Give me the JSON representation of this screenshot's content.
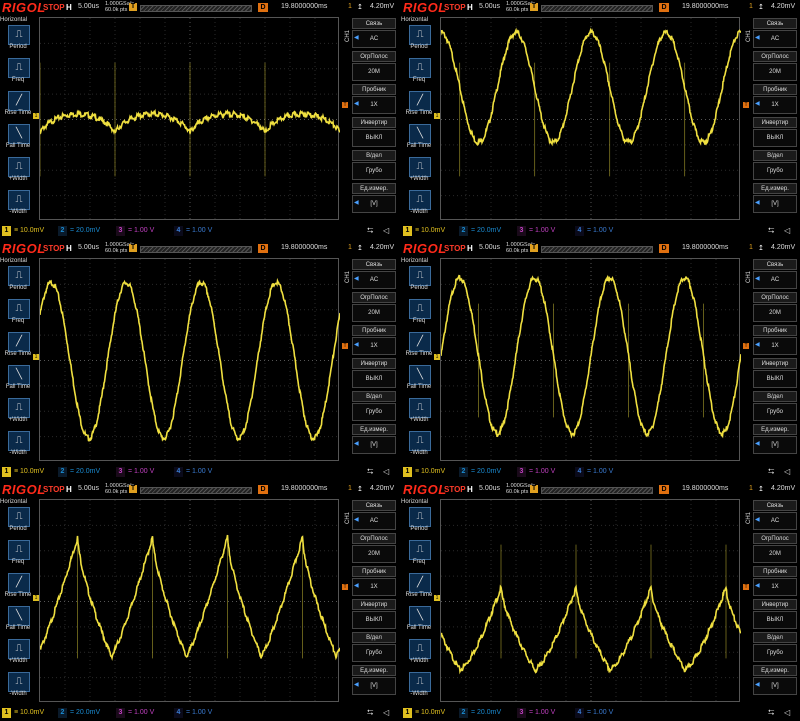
{
  "brand": "RIGOL",
  "status": "STOP",
  "hmark": "H",
  "timebase": "5.00us",
  "sample_rate_line1": "1.000GSa/s",
  "sample_rate_line2": "60.0k pts",
  "trig_label": "D",
  "delay": "19.8000000ms",
  "trig_channel": "1",
  "trig_level": "4.20mV",
  "left_menu": {
    "title": "Horizontal",
    "items": [
      "Period",
      "Freq",
      "Rise Time",
      "Fall Time",
      "+Width",
      "-Width"
    ]
  },
  "right_menu": {
    "channel": "CH1",
    "items": [
      {
        "label": "Связь",
        "value": "AC"
      },
      {
        "label": "ОгрПолос",
        "value": "20M"
      },
      {
        "label": "Пробник",
        "value": "1X"
      },
      {
        "label": "Инвертир",
        "value": "ВЫКЛ"
      },
      {
        "label": "В/дел",
        "value": "Грубо"
      },
      {
        "label": "Ед.измер.",
        "value": "[V]"
      }
    ]
  },
  "channels": [
    {
      "num": "1",
      "value": "10.0mV"
    },
    {
      "num": "2",
      "value": "20.0mV"
    },
    {
      "num": "3",
      "value": "1.00 V"
    },
    {
      "num": "4",
      "value": "1.00 V"
    }
  ],
  "colors": {
    "trace": "#f0e040",
    "brand": "#ff2a1a",
    "grid": "#333333"
  },
  "panels": [
    {
      "shape": "dips",
      "phase": 0.0,
      "amp": 0.22,
      "offset": -0.05
    },
    {
      "shape": "sine_spikes",
      "phase": 0.25,
      "amp": 0.6,
      "offset": 0.35
    },
    {
      "shape": "sine_clean",
      "phase": 0.1,
      "amp": 0.85,
      "offset": 0.0
    },
    {
      "shape": "sine_spikes2",
      "phase": 0.0,
      "amp": 0.85,
      "offset": 0.05
    },
    {
      "shape": "saw_rise",
      "phase": 0.05,
      "amp": 0.65,
      "offset": 0.05
    },
    {
      "shape": "saw_fall",
      "phase": 0.2,
      "amp": 0.45,
      "offset": -0.3
    }
  ]
}
